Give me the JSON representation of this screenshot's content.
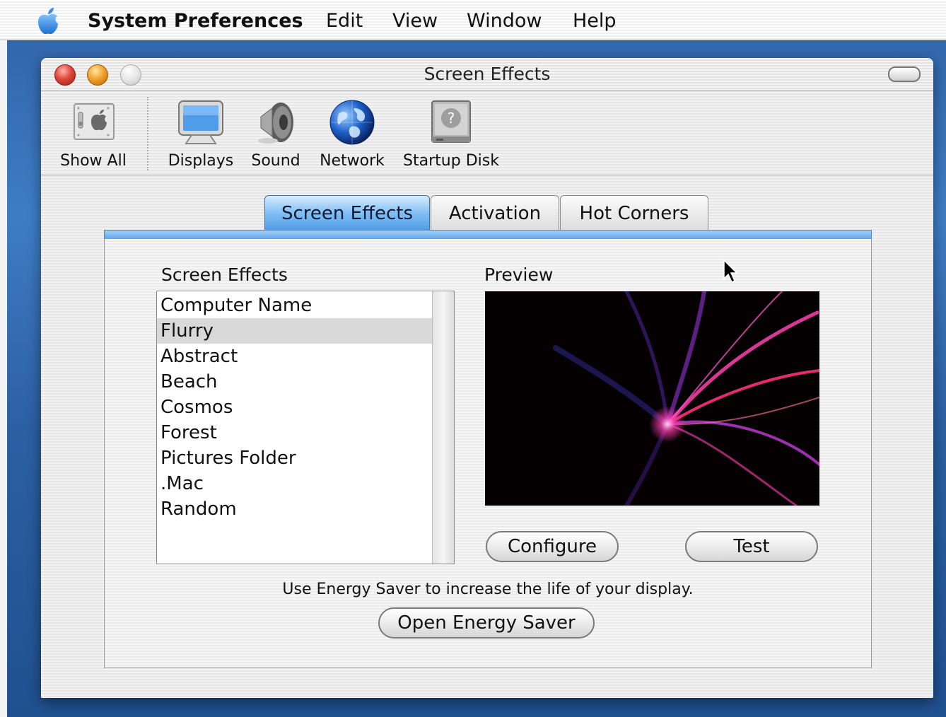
{
  "menubar": {
    "apple_icon": "apple-logo-icon",
    "app_name": "System Preferences",
    "items": [
      "Edit",
      "View",
      "Window",
      "Help"
    ]
  },
  "window": {
    "title": "Screen Effects"
  },
  "toolbar": {
    "items": [
      {
        "label": "Show All",
        "icon": "show-all-icon"
      },
      {
        "label": "Displays",
        "icon": "display-icon"
      },
      {
        "label": "Sound",
        "icon": "speaker-icon"
      },
      {
        "label": "Network",
        "icon": "globe-icon"
      },
      {
        "label": "Startup Disk",
        "icon": "hard-disk-icon"
      }
    ]
  },
  "tabs": [
    {
      "label": "Screen Effects",
      "active": true
    },
    {
      "label": "Activation",
      "active": false
    },
    {
      "label": "Hot Corners",
      "active": false
    }
  ],
  "panel": {
    "list_label": "Screen Effects",
    "preview_label": "Preview",
    "effects": [
      "Computer Name",
      "Flurry",
      "Abstract",
      "Beach",
      "Cosmos",
      "Forest",
      "Pictures Folder",
      ".Mac",
      "Random"
    ],
    "selected_effect": "Flurry",
    "configure_label": "Configure",
    "test_label": "Test",
    "hint": "Use Energy Saver to increase the life of your display.",
    "energy_button_label": "Open Energy Saver"
  },
  "colors": {
    "desktop": "#2e62a6",
    "tab_active": "#6fb3f0",
    "preview_bg": "#050103",
    "flurry_pink": "#ff3fb0",
    "flurry_purple": "#7a3cff"
  }
}
